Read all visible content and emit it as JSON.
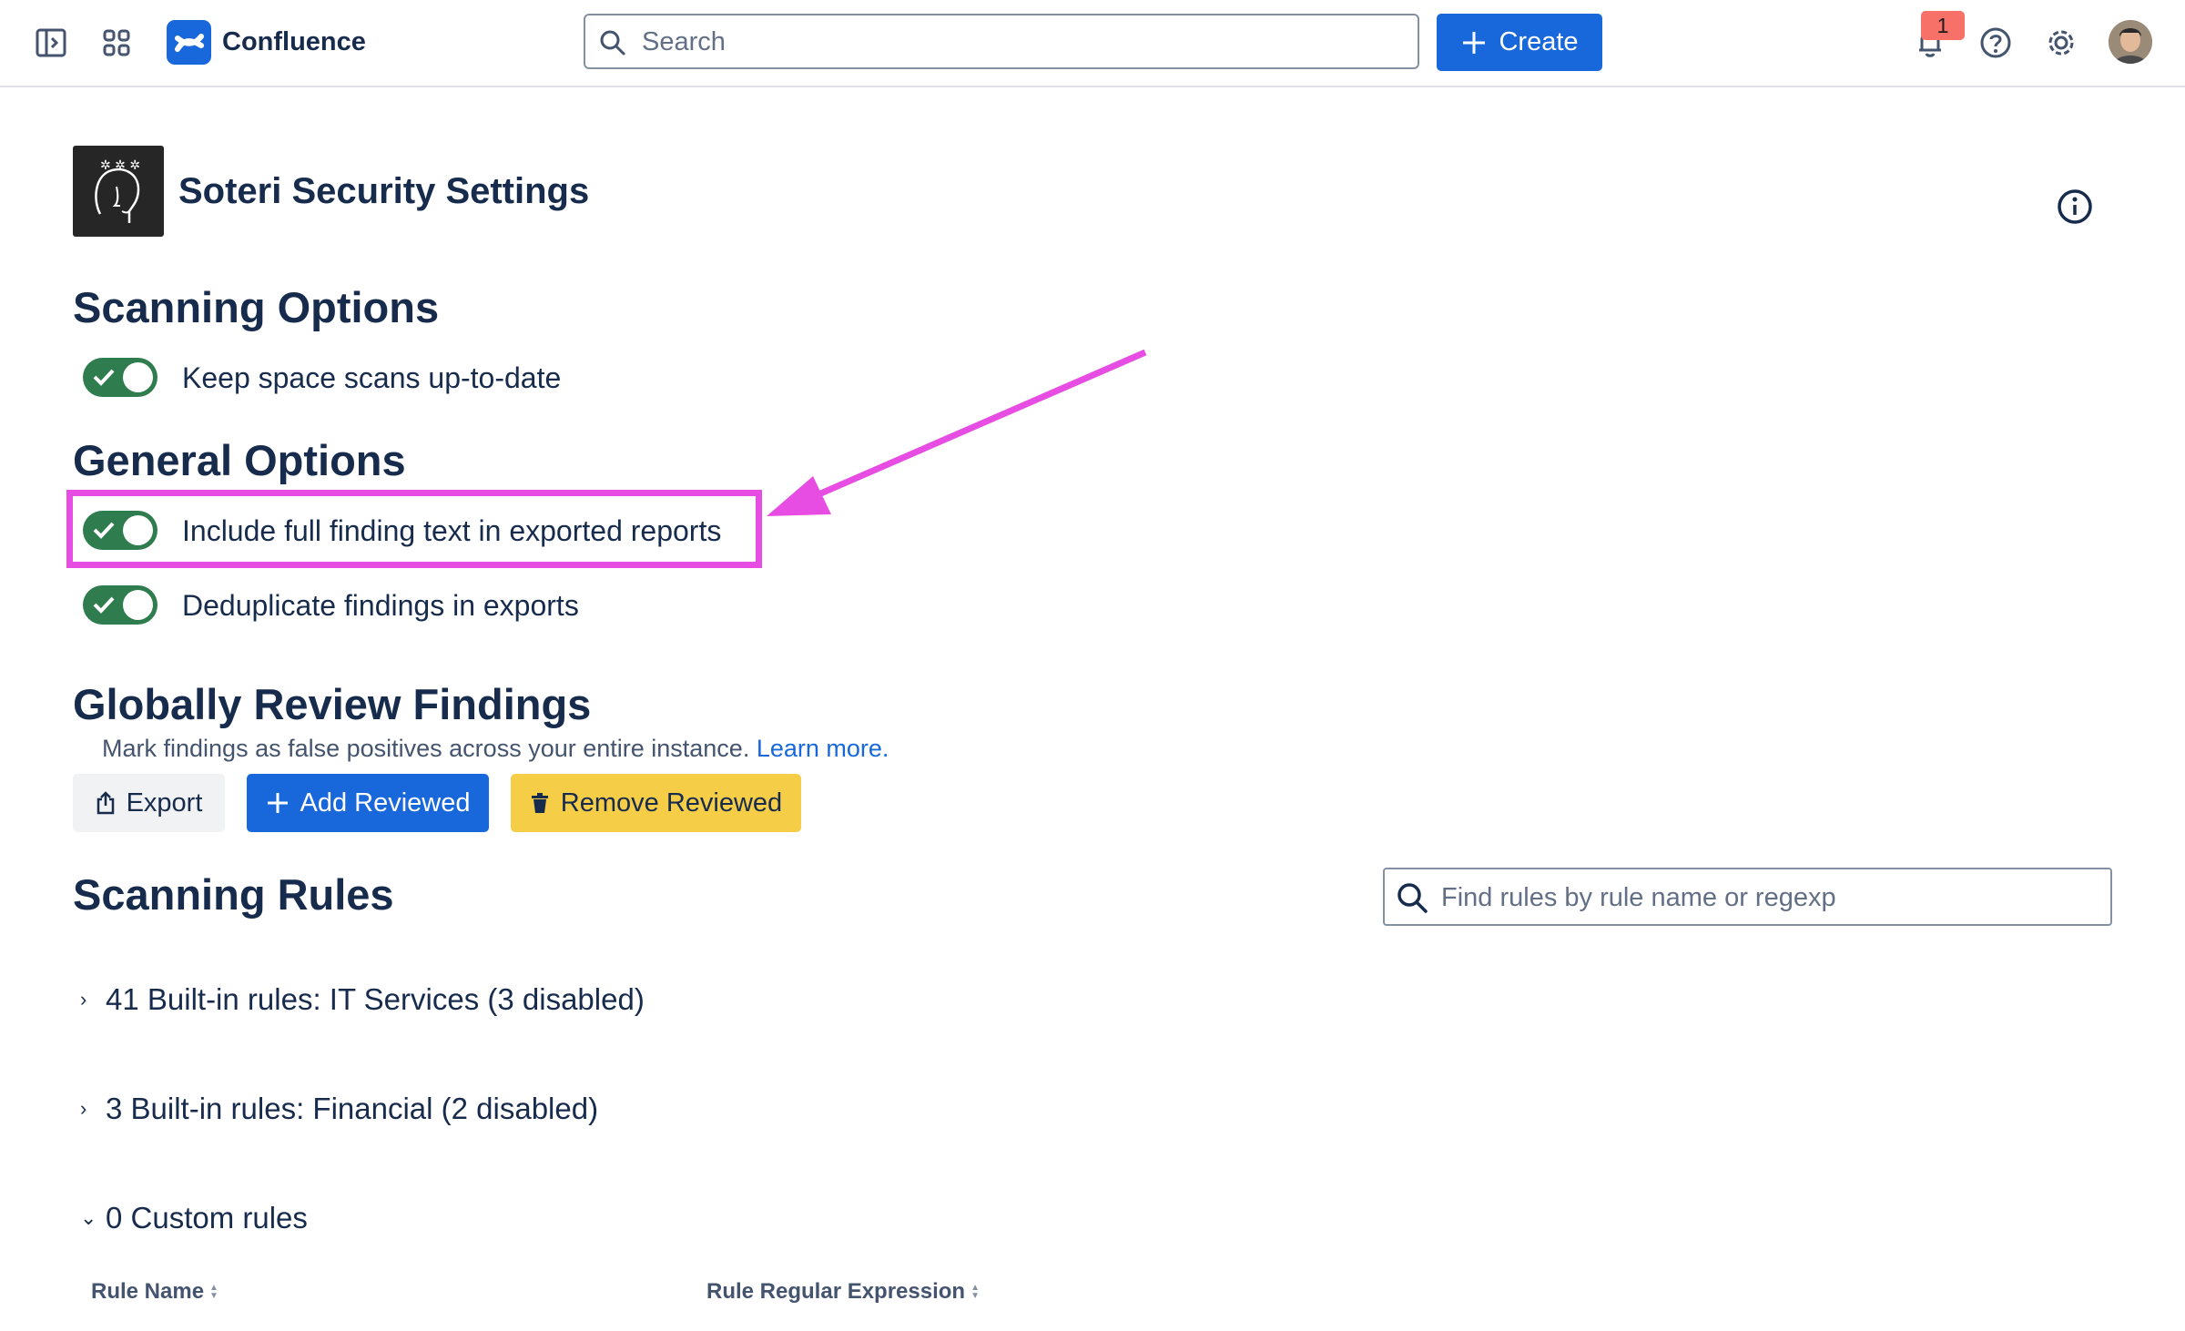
{
  "topbar": {
    "app_name": "Confluence",
    "search_placeholder": "Search",
    "create_label": "Create",
    "notification_count": "1"
  },
  "page": {
    "title": "Soteri Security Settings"
  },
  "scanning_options": {
    "heading": "Scanning Options",
    "items": [
      {
        "label": "Keep space scans up-to-date",
        "enabled": true
      }
    ]
  },
  "general_options": {
    "heading": "General Options",
    "items": [
      {
        "label": "Include full finding text in exported reports",
        "enabled": true
      },
      {
        "label": "Deduplicate findings in exports",
        "enabled": true
      }
    ]
  },
  "review": {
    "heading": "Globally Review Findings",
    "description": "Mark findings as false positives across your entire instance.",
    "learn_more": "Learn more.",
    "export_label": "Export",
    "add_label": "Add Reviewed",
    "remove_label": "Remove Reviewed"
  },
  "rules": {
    "heading": "Scanning Rules",
    "search_placeholder": "Find rules by rule name or regexp",
    "groups": [
      {
        "label": "41 Built-in rules: IT Services (3 disabled)",
        "expanded": false
      },
      {
        "label": "3 Built-in rules: Financial (2 disabled)",
        "expanded": false
      },
      {
        "label": "0 Custom rules",
        "expanded": true
      }
    ],
    "columns": [
      "Rule Name",
      "Rule Regular Expression"
    ]
  },
  "colors": {
    "primary": "#1868db",
    "toggle_on": "#2f7d4f",
    "warning": "#f5cd47",
    "annotation": "#e84de3"
  }
}
